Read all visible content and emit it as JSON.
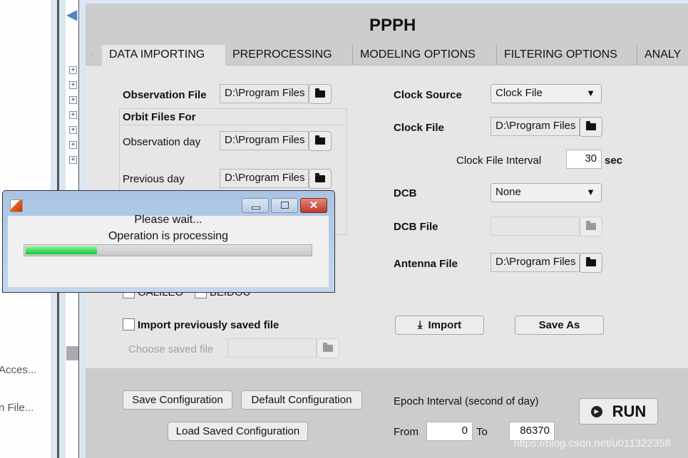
{
  "sidebar": {
    "items": [
      "Acces...",
      "n File..."
    ],
    "tree_nodes": 7
  },
  "app": {
    "title": "PPPH"
  },
  "tabs": [
    {
      "label": "DATA IMPORTING",
      "active": true
    },
    {
      "label": "PREPROCESSING"
    },
    {
      "label": "MODELING OPTIONS"
    },
    {
      "label": "FILTERING OPTIONS"
    },
    {
      "label": "ANALY"
    }
  ],
  "left": {
    "observation_file_label": "Observation File",
    "observation_file_value": "D:\\Program Files",
    "orbit_group_title": "Orbit Files For",
    "observation_day_label": "Observation day",
    "observation_day_value": "D:\\Program Files",
    "previous_day_label": "Previous day",
    "previous_day_value": "D:\\Program Files",
    "galileo_label": "GALILEO",
    "beidou_label": "BEIDOU",
    "import_saved_label": "Import previously saved file",
    "choose_saved_label": "Choose saved file",
    "choose_saved_value": ""
  },
  "right": {
    "clock_source_label": "Clock Source",
    "clock_source_value": "Clock File",
    "clock_file_label": "Clock File",
    "clock_file_value": "D:\\Program Files",
    "clock_interval_label": "Clock File Interval",
    "clock_interval_value": "30",
    "clock_interval_unit": "sec",
    "dcb_label": "DCB",
    "dcb_value": "None",
    "dcb_file_label": "DCB File",
    "dcb_file_value": "",
    "antenna_file_label": "Antenna File",
    "antenna_file_value": "D:\\Program Files",
    "import_button": "Import",
    "save_as_button": "Save As"
  },
  "bottom": {
    "save_config": "Save Configuration",
    "default_config": "Default Configuration",
    "load_config": "Load Saved Configuration",
    "epoch_label": "Epoch Interval (second of day)",
    "from_label": "From",
    "from_value": "0",
    "to_label": "To",
    "to_value": "86370",
    "run_button": "RUN"
  },
  "dialog": {
    "line1": "Please wait...",
    "line2": "Operation is processing",
    "progress_percent": 25,
    "progress_color": "#11cc33"
  },
  "watermark": "https://blog.csdn.net/u011322358"
}
